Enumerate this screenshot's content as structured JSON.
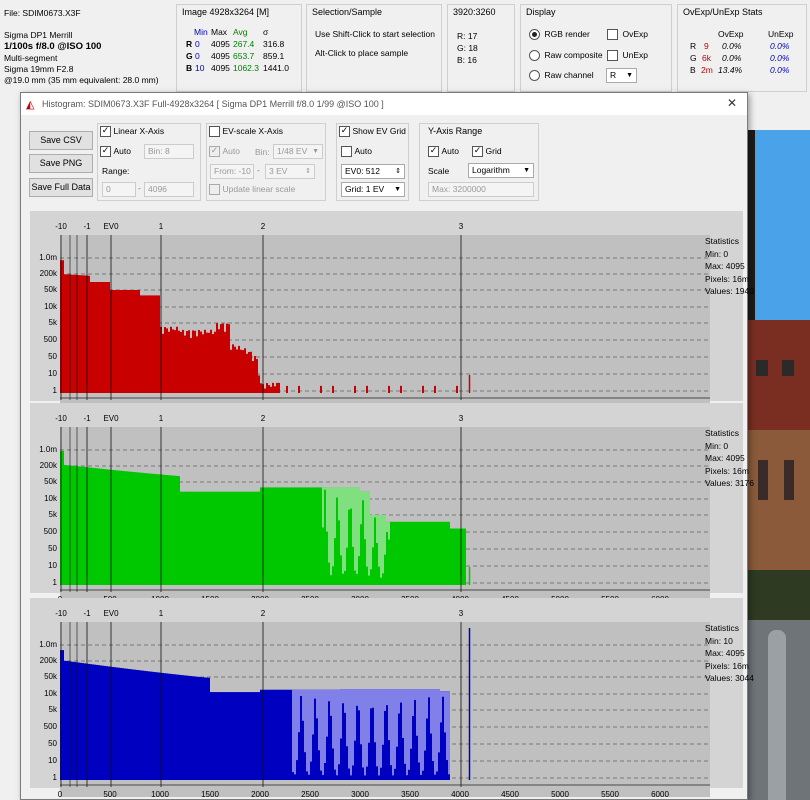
{
  "file": {
    "label": "File: SDIM0673.X3F",
    "camera": "Sigma DP1 Merrill",
    "exposure": "1/100s f/8.0 @ISO 100",
    "mode": "Multi-segment",
    "lens": "Sigma 19mm F2.8",
    "focal": "@19.0 mm (35 mm equivalent: 28.0 mm)"
  },
  "image": {
    "title": "Image 4928x3264 [M]",
    "headers": [
      "Min",
      "Max",
      "Avg",
      "σ"
    ],
    "rows": [
      {
        "ch": "R",
        "min": "0",
        "max": "4095",
        "avg": "267.4",
        "sd": "316.8"
      },
      {
        "ch": "G",
        "min": "0",
        "max": "4095",
        "avg": "653.7",
        "sd": "859.1"
      },
      {
        "ch": "B",
        "min": "10",
        "max": "4095",
        "avg": "1062.3",
        "sd": "1441.0"
      }
    ]
  },
  "selection": {
    "title": "Selection/Sample",
    "line1": "Use Shift-Click to start selection",
    "line2": "Alt-Click to place sample"
  },
  "coords": {
    "title": "3920:3260",
    "r": "R:  17",
    "g": "G:  18",
    "b": "B:  16"
  },
  "display": {
    "title": "Display",
    "rgb": "RGB render",
    "raw": "Raw composite",
    "channel": "Raw channel",
    "channel_value": "R",
    "ovexp": "OvExp",
    "unexp": "UnExp"
  },
  "ovexp_stats": {
    "title": "OvExp/UnExp Stats",
    "headers": [
      "OvExp",
      "UnExp"
    ],
    "rows": [
      {
        "ch": "R",
        "n": "9",
        "ov": "0.0%",
        "un": "0.0%"
      },
      {
        "ch": "G",
        "n": "6k",
        "ov": "0.0%",
        "un": "0.0%"
      },
      {
        "ch": "B",
        "n": "2m",
        "ov": "13.4%",
        "un": "0.0%"
      }
    ]
  },
  "histogram_window": {
    "title": "Histogram: SDIM0673.X3F Full-4928x3264 [ Sigma DP1 Merrill f/8.0 1/99 @ISO 100 ]",
    "close": "✕",
    "save_csv": "Save CSV",
    "save_png": "Save PNG",
    "save_full": "Save Full Data",
    "linear": {
      "title": "Linear X-Axis",
      "auto": "Auto",
      "bin": "Bin: 8",
      "range": "Range:",
      "from": "0",
      "to": "4096"
    },
    "evscale": {
      "title": "EV-scale X-Axis",
      "auto": "Auto",
      "bin": "Bin:",
      "bin_value": "1/48 EV",
      "from": "From: -10",
      "to": "3 EV",
      "update": "Update linear scale"
    },
    "evgrid": {
      "title": "Show EV Grid",
      "auto": "Auto",
      "ev0": "EV0: 512",
      "grid": "Grid: 1 EV"
    },
    "yaxis": {
      "title": "Y-Axis Range",
      "auto": "Auto",
      "grid": "Grid",
      "scale": "Scale",
      "scale_value": "Logarithm",
      "max": "Max: 3200000"
    }
  },
  "axes": {
    "ev_labels": [
      "-10",
      "-1",
      "EV0",
      "1",
      "2",
      "3"
    ],
    "y_labels": [
      "1.0m",
      "200k",
      "50k",
      "10k",
      "5k",
      "500",
      "50",
      "10",
      "1"
    ],
    "x_labels": [
      "0",
      "500",
      "1000",
      "1500",
      "2000",
      "2500",
      "3000",
      "3500",
      "4000",
      "4500",
      "5000",
      "5500",
      "6000"
    ]
  },
  "stats_label": "Statistics",
  "panels": [
    {
      "channel": "red",
      "color": "#c80000",
      "light": "#e08080",
      "min": "Min: 0",
      "max": "Max: 4095",
      "pixels": "Pixels: 16m",
      "values": "Values: 1940"
    },
    {
      "channel": "green",
      "color": "#00c800",
      "light": "#80e080",
      "min": "Min: 0",
      "max": "Max: 4095",
      "pixels": "Pixels: 16m",
      "values": "Values: 3176"
    },
    {
      "channel": "blue",
      "color": "#0000c0",
      "light": "#8080e8",
      "min": "Min: 10",
      "max": "Max: 4095",
      "pixels": "Pixels: 16m",
      "values": "Values: 3044"
    }
  ],
  "colors": {
    "plot_bg": "#c0c0c0",
    "window_bg": "#f0f0f0",
    "sky": "#4aa3e8"
  }
}
